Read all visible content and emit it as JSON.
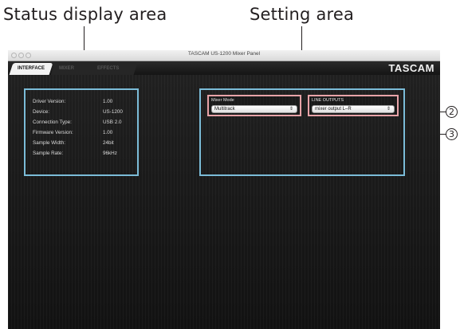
{
  "callouts": {
    "status_area": "Status display area",
    "setting_area": "Setting area",
    "num_2": "2",
    "num_3": "3"
  },
  "window": {
    "title": "TASCAM US-1200 Mixer Panel",
    "brand": "TASCAM"
  },
  "tabs": [
    {
      "label": "INTERFACE",
      "active": true
    },
    {
      "label": "MIXER",
      "active": false
    },
    {
      "label": "EFFECTS",
      "active": false
    }
  ],
  "status": [
    {
      "label": "Driver Version:",
      "value": "1.00"
    },
    {
      "label": "Device:",
      "value": "US-1200"
    },
    {
      "label": "Connection Type:",
      "value": "USB 2.0"
    },
    {
      "label": "Firmware Version:",
      "value": "1.00"
    },
    {
      "label": "Sample Width:",
      "value": "24bit"
    },
    {
      "label": "Sample Rate:",
      "value": "96kHz"
    }
  ],
  "settings": {
    "mixer_mode": {
      "label": "Mixer Mode",
      "value": "Multitrack"
    },
    "line_outputs": {
      "label": "LINE OUTPUTS",
      "value": "mixer output L–R"
    }
  },
  "colors": {
    "area_outline": "#7bbcd8",
    "control_outline": "#e8a3a8",
    "content_bg": "#1a1a1a"
  }
}
